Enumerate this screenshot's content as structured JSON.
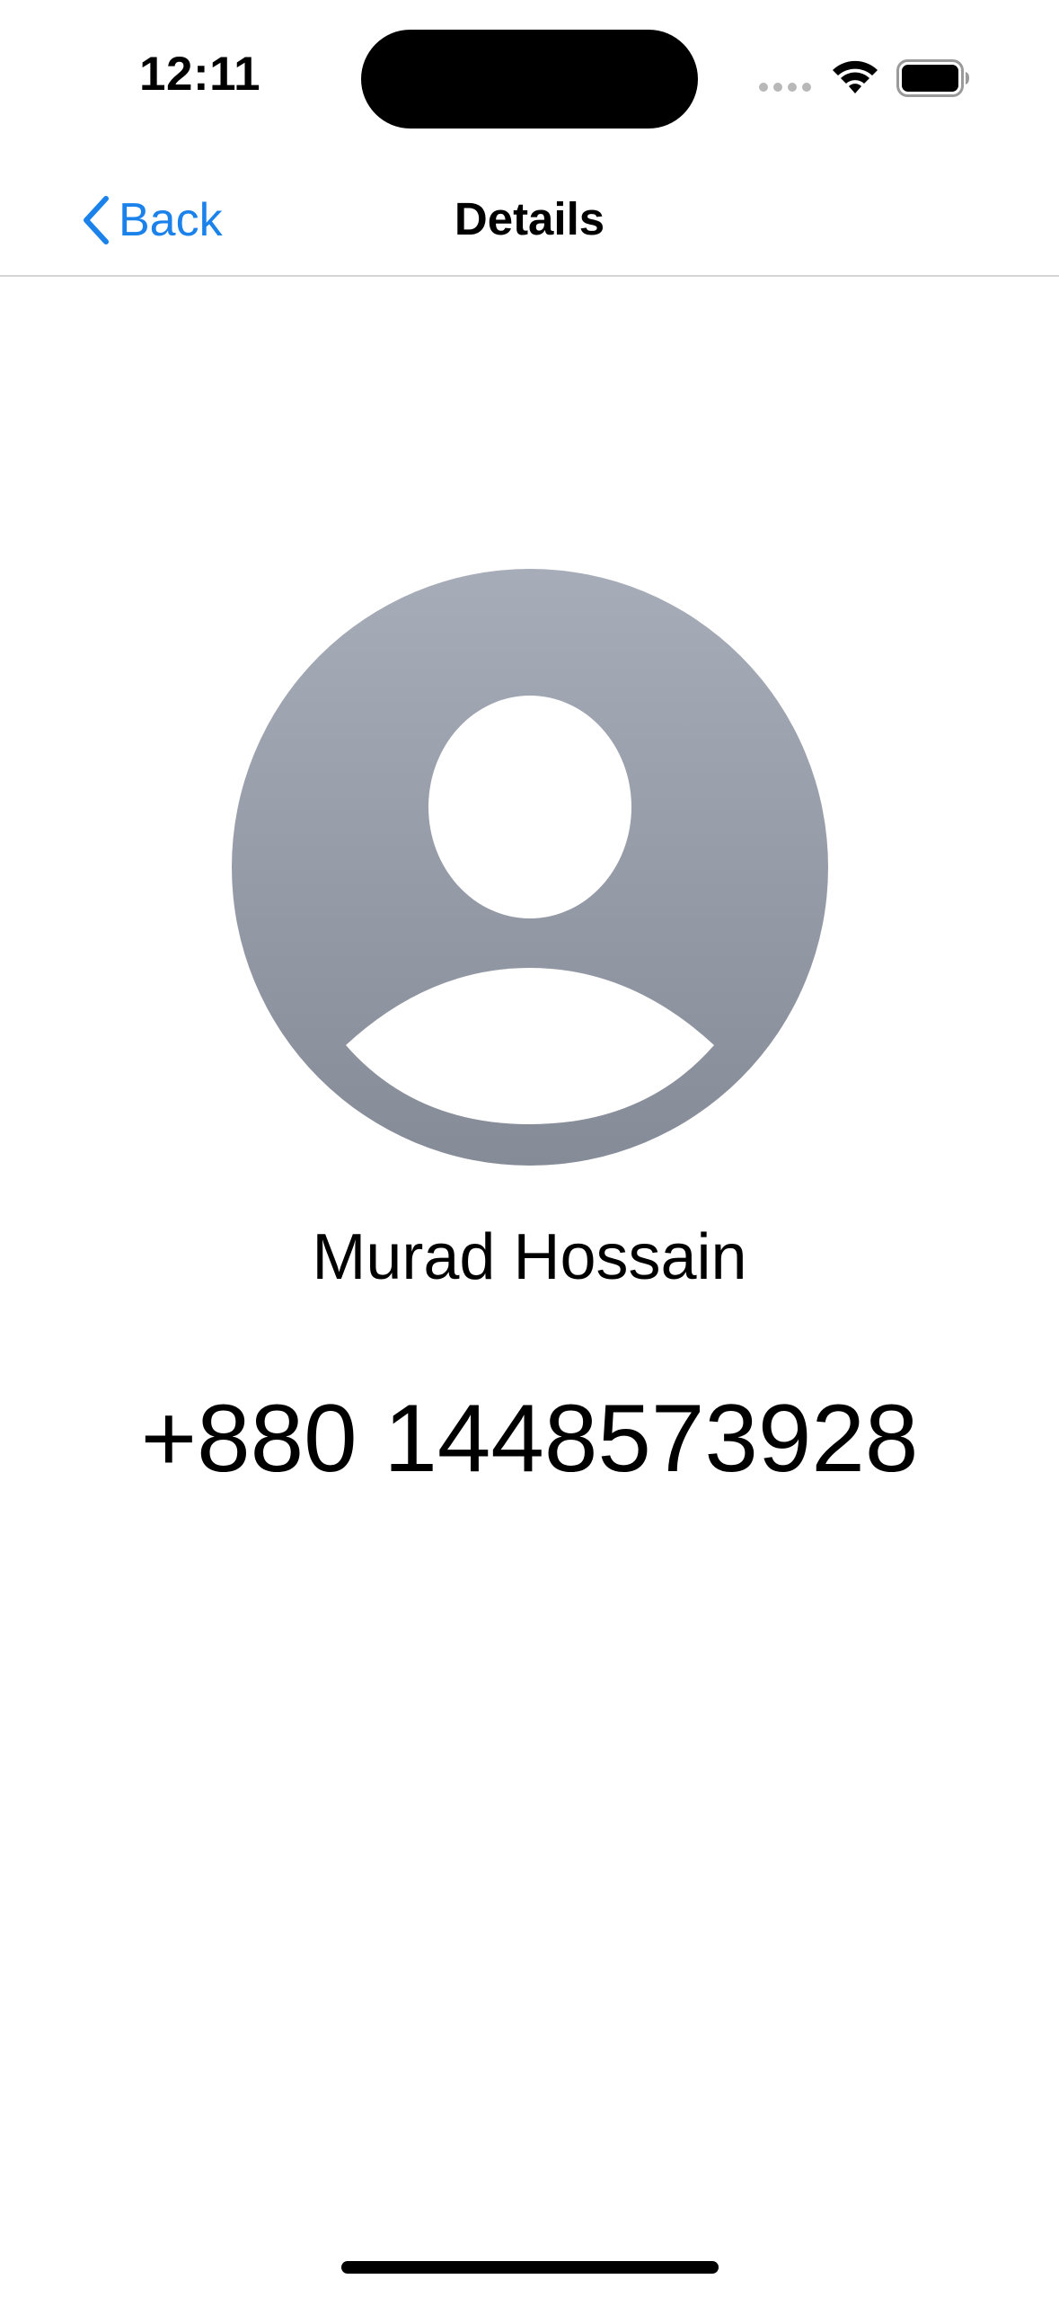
{
  "status_bar": {
    "time": "12:11",
    "icons": [
      "signal-icon",
      "wifi-icon",
      "battery-icon"
    ]
  },
  "nav": {
    "back_label": "Back",
    "title": "Details",
    "accent_color": "#1a82ea"
  },
  "contact": {
    "avatar_icon": "person-placeholder-icon",
    "name": "Murad Hossain",
    "phone": "+880 1448573928"
  }
}
